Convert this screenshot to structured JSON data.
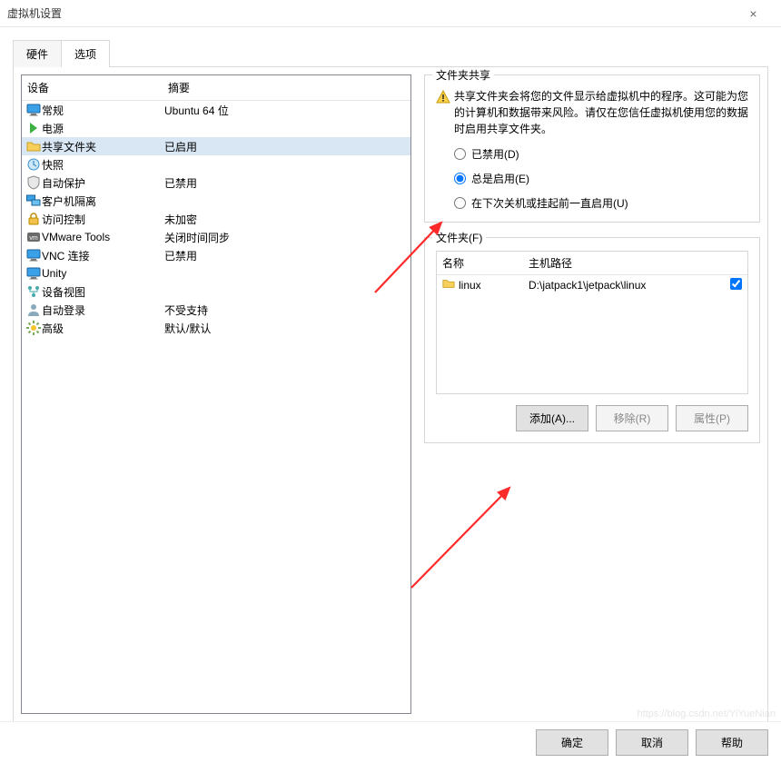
{
  "window": {
    "title": "虚拟机设置",
    "close": "×"
  },
  "tabs": {
    "hardware": "硬件",
    "options": "选项"
  },
  "columns": {
    "device": "设备",
    "summary": "摘要"
  },
  "devices": [
    {
      "icon": "monitor",
      "name": "常规",
      "summary": "Ubuntu 64 位"
    },
    {
      "icon": "power",
      "name": "电源",
      "summary": ""
    },
    {
      "icon": "folder",
      "name": "共享文件夹",
      "summary": "已启用",
      "selected": true
    },
    {
      "icon": "clock",
      "name": "快照",
      "summary": ""
    },
    {
      "icon": "shield",
      "name": "自动保护",
      "summary": "已禁用"
    },
    {
      "icon": "displays",
      "name": "客户机隔离",
      "summary": ""
    },
    {
      "icon": "lock",
      "name": "访问控制",
      "summary": "未加密"
    },
    {
      "icon": "vmw",
      "name": "VMware Tools",
      "summary": "关闭时间同步"
    },
    {
      "icon": "monitor",
      "name": "VNC 连接",
      "summary": "已禁用"
    },
    {
      "icon": "monitor",
      "name": "Unity",
      "summary": ""
    },
    {
      "icon": "schema",
      "name": "设备视图",
      "summary": ""
    },
    {
      "icon": "user",
      "name": "自动登录",
      "summary": "不受支持"
    },
    {
      "icon": "gear",
      "name": "高级",
      "summary": "默认/默认"
    }
  ],
  "share": {
    "legend": "文件夹共享",
    "warning": "共享文件夹会将您的文件显示给虚拟机中的程序。这可能为您的计算机和数据带来风险。请仅在您信任虚拟机使用您的数据时启用共享文件夹。",
    "r_disabled": "已禁用(D)",
    "r_always": "总是启用(E)",
    "r_until": "在下次关机或挂起前一直启用(U)"
  },
  "folders": {
    "legend": "文件夹(F)",
    "col_name": "名称",
    "col_path": "主机路径",
    "rows": [
      {
        "name": "linux",
        "path": "D:\\jatpack1\\jetpack\\linux",
        "checked": true
      }
    ]
  },
  "btns": {
    "add": "添加(A)...",
    "remove": "移除(R)",
    "props": "属性(P)"
  },
  "footer": {
    "ok": "确定",
    "cancel": "取消",
    "help": "帮助"
  },
  "watermark": "https://blog.csdn.net/YiYueNian"
}
